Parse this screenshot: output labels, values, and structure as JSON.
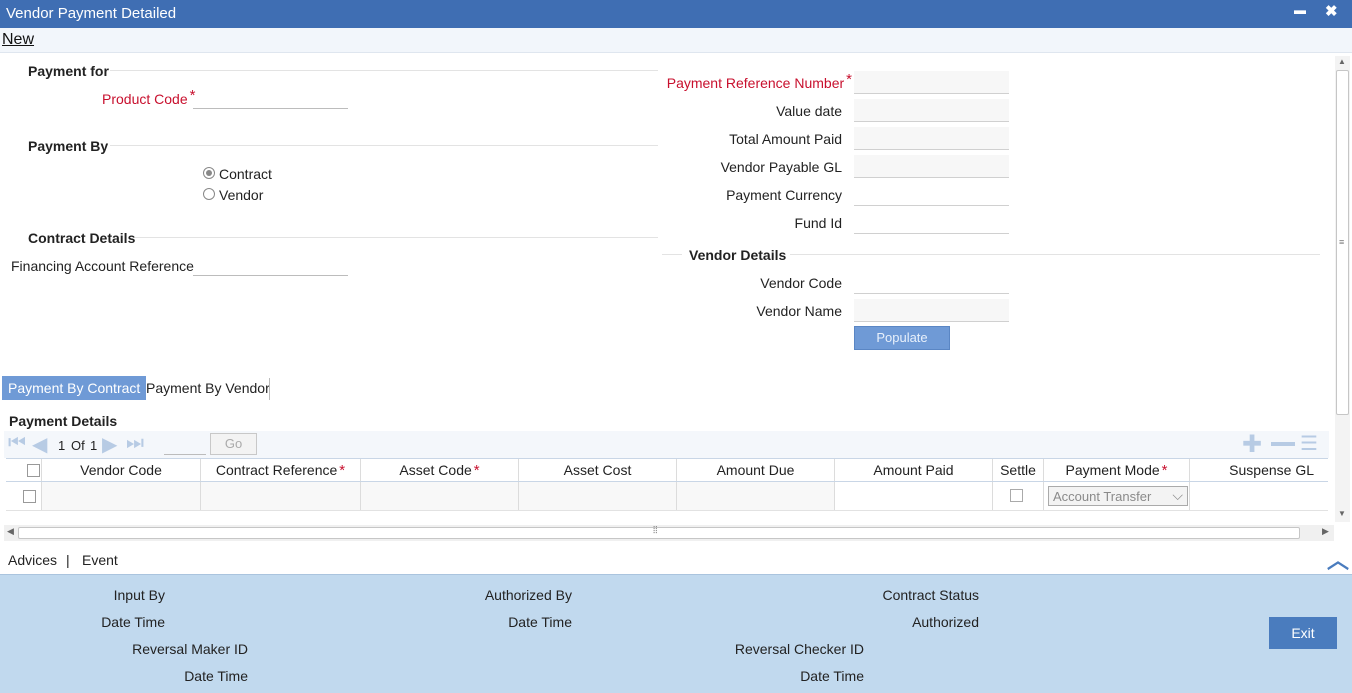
{
  "window": {
    "title": "Vendor Payment Detailed",
    "minimize": "▬",
    "close": "✖"
  },
  "menu": {
    "new": "New"
  },
  "payment_for": {
    "heading": "Payment for",
    "product_code_label": "Product Code",
    "required_mark": "*"
  },
  "payment_by": {
    "heading": "Payment By",
    "options": [
      "Contract",
      "Vendor"
    ],
    "selected": "Contract"
  },
  "contract_details": {
    "heading": "Contract Details",
    "financing_account_reference_label": "Financing Account Reference"
  },
  "right_fields": {
    "payment_reference_number": "Payment Reference Number",
    "value_date": "Value date",
    "total_amount_paid": "Total Amount Paid",
    "vendor_payable_gl": "Vendor Payable GL",
    "payment_currency": "Payment Currency",
    "fund_id": "Fund Id"
  },
  "vendor_details": {
    "heading": "Vendor Details",
    "vendor_code": "Vendor Code",
    "vendor_name": "Vendor Name",
    "populate_button": "Populate"
  },
  "tabs": [
    "Payment By Contract",
    "Payment By Vendor"
  ],
  "payment_details": {
    "heading": "Payment Details",
    "pager": {
      "current": "1",
      "of_label": "Of",
      "total": "1",
      "go": "Go"
    },
    "columns": [
      "Vendor Code",
      "Contract Reference",
      "Asset Code",
      "Asset Cost",
      "Amount Due",
      "Amount Paid",
      "Settle",
      "Payment Mode",
      "Suspense GL"
    ],
    "row_payment_mode": "Account Transfer"
  },
  "links": {
    "advices": "Advices",
    "separator": "|",
    "event": "Event"
  },
  "footer": {
    "input_by": "Input By",
    "date_time": "Date Time",
    "authorized_by": "Authorized By",
    "contract_status": "Contract Status",
    "authorized": "Authorized",
    "reversal_maker_id": "Reversal Maker ID",
    "reversal_checker_id": "Reversal Checker ID",
    "exit": "Exit"
  }
}
